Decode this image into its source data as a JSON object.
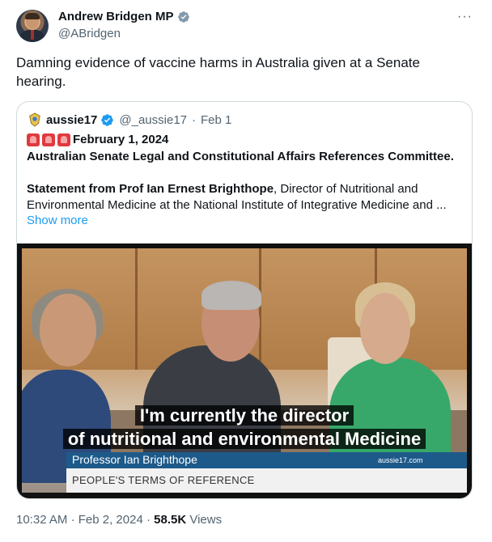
{
  "author": {
    "display_name": "Andrew Bridgen MP",
    "handle": "@ABridgen",
    "verified_badge": "grey-check-icon"
  },
  "more_icon_label": "···",
  "tweet_text": "Damning evidence of vaccine harms in Australia given at a Senate hearing.",
  "quoted": {
    "display_name": "aussie17",
    "handle": "@_aussie17",
    "separator": "·",
    "date": "Feb 1",
    "date_line": "February 1, 2024",
    "committee": "Australian Senate Legal and Constitutional Affairs References Committee.",
    "statement_bold": "Statement from Prof Ian Ernest Brighthope",
    "statement_rest": ", Director of Nutritional and",
    "statement_line2": "Environmental Medicine at the National Institute of Integrative Medicine and ...",
    "show_more": "Show more",
    "video": {
      "caption_line1": "I'm currently the director",
      "caption_line2": "of nutritional and environmental Medicine",
      "lower_name": "Professor Ian Brighthope",
      "watermark": "aussie17.com",
      "lower_ref": "PEOPLE'S TERMS OF REFERENCE"
    }
  },
  "footer": {
    "time": "10:32 AM",
    "sep1": "·",
    "date": "Feb 2, 2024",
    "sep2": "·",
    "views": "58.5K",
    "views_label": "Views"
  },
  "colors": {
    "accent": "#1d9bf0",
    "secondary_text": "#536471",
    "border": "#cfd9de"
  }
}
